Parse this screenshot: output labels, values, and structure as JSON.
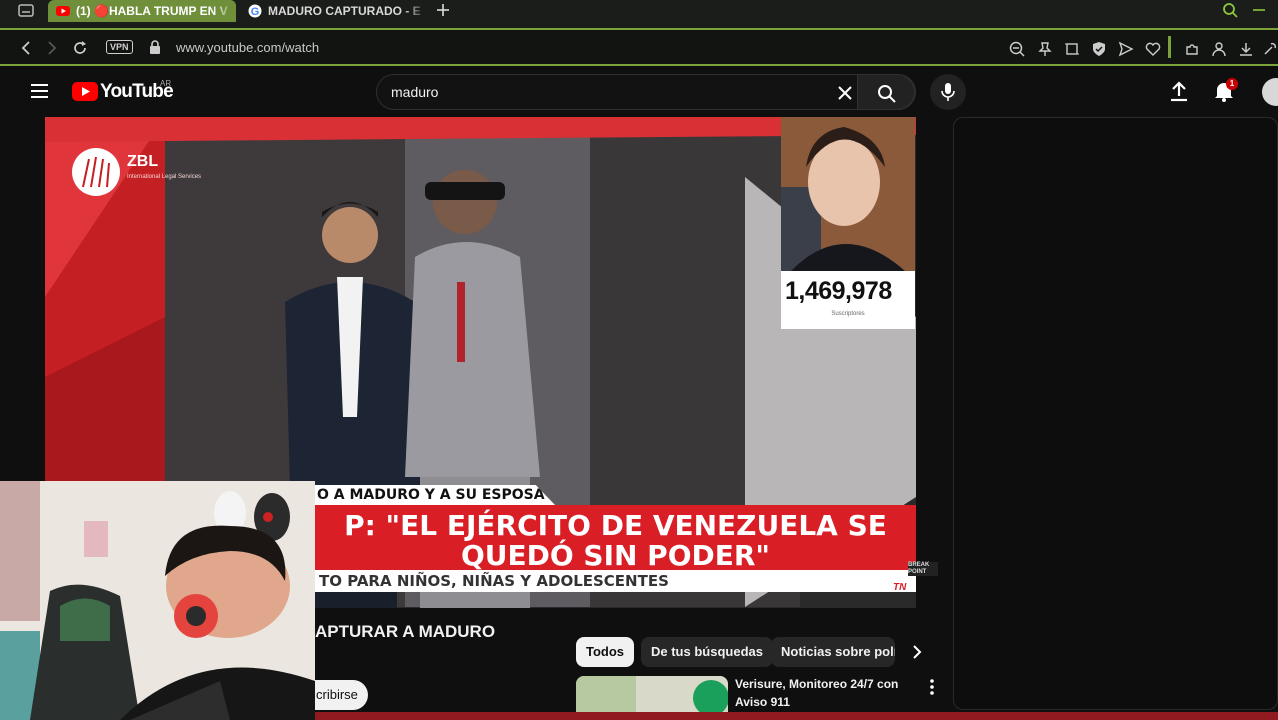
{
  "tabs": [
    {
      "label": "(1) 🔴HABLA TRUMP EN V",
      "active": true
    },
    {
      "label": "MADURO CAPTURADO - E",
      "active": false
    }
  ],
  "address": {
    "url": "www.youtube.com/watch",
    "vpn_label": "VPN"
  },
  "youtube": {
    "logo_text": "YouTube",
    "country_code": "AR",
    "search_value": "maduro",
    "notification_count": "1"
  },
  "video": {
    "brand_logo_text": "ZBL",
    "brand_tagline": "International Legal Services",
    "top_banner": "O A MADURO Y A SU ESPOSA",
    "headline_line1": "P: \"EL EJÉRCITO DE VENEZUELA SE",
    "headline_line2": "QUEDÓ SIN PODER\"",
    "sub_banner": "TO PARA NIÑOS, NIÑAS Y ADOLESCENTES",
    "channel_bug": "TN",
    "corner_tag": "BREAK POINT"
  },
  "subscriber_overlay": {
    "count": "1,469,978",
    "label": "Suscriptores"
  },
  "below_video": {
    "title": "APTURAR A MADURO",
    "subscribe_label": "cribirse",
    "chips": [
      "Todos",
      "De tus búsquedas",
      "Noticias sobre polí"
    ]
  },
  "suggested": {
    "title_line1": "Verisure, Monitoreo 24/7 con",
    "title_line2": "Aviso 911"
  },
  "colors": {
    "accent": "#7aa33a",
    "yt_red": "#ff0000",
    "news_red": "#d91e26",
    "bg": "#0f0f0f"
  }
}
